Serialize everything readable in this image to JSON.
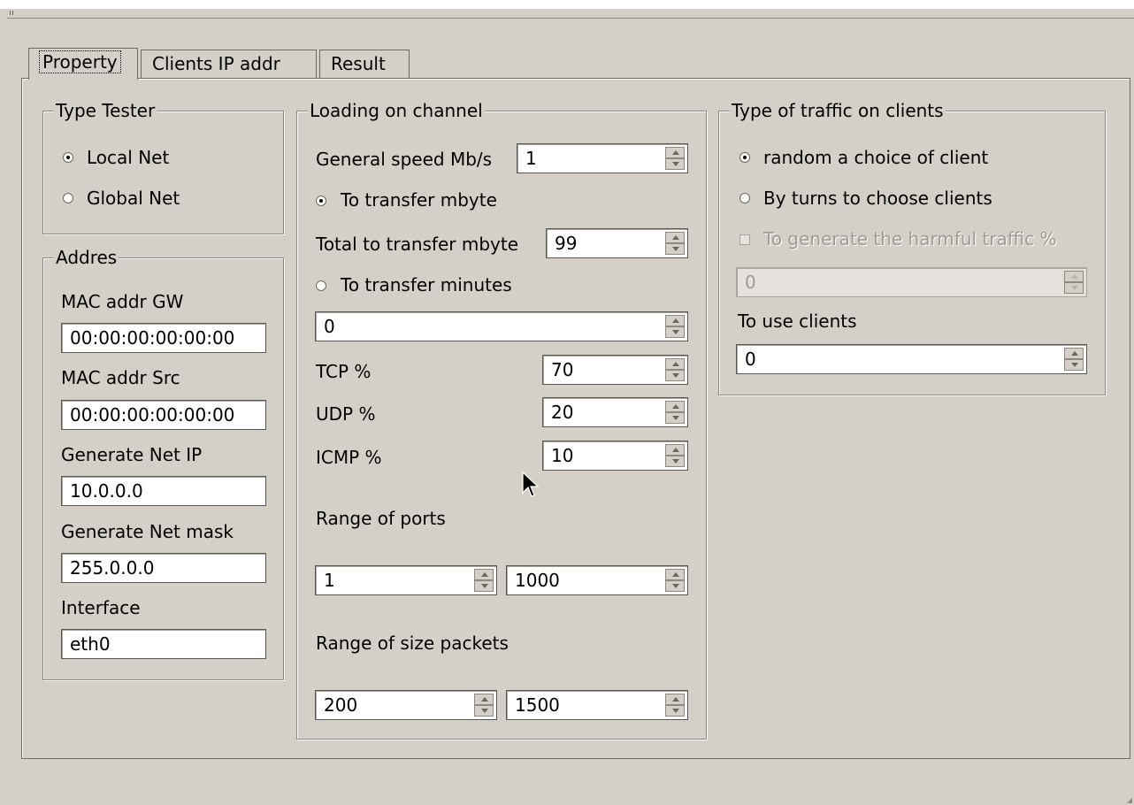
{
  "tabs": [
    {
      "label": "Property",
      "active": true
    },
    {
      "label": "Clients IP addr",
      "active": false
    },
    {
      "label": "Result",
      "active": false
    }
  ],
  "type_tester": {
    "title": "Type Tester",
    "local_net": "Local Net",
    "global_net": "Global Net",
    "selected": "Local Net"
  },
  "addres": {
    "title": "Addres",
    "mac_gw_label": "MAC addr GW",
    "mac_gw_value": "00:00:00:00:00:00",
    "mac_src_label": "MAC addr Src",
    "mac_src_value": "00:00:00:00:00:00",
    "net_ip_label": "Generate Net IP",
    "net_ip_value": "10.0.0.0",
    "net_mask_label": "Generate Net mask",
    "net_mask_value": "255.0.0.0",
    "interface_label": "Interface",
    "interface_value": "eth0"
  },
  "loading": {
    "title": "Loading on channel",
    "general_speed_label": "General speed Mb/s",
    "general_speed_value": "1",
    "transfer_mbyte_label": "To transfer mbyte",
    "total_mbyte_label": "Total to transfer mbyte",
    "total_mbyte_value": "99",
    "transfer_minutes_label": "To transfer minutes",
    "minutes_value": "0",
    "tcp_label": "TCP %",
    "tcp_value": "70",
    "udp_label": "UDP %",
    "udp_value": "20",
    "icmp_label": "ICMP %",
    "icmp_value": "10",
    "range_ports_label": "Range of ports",
    "port_from": "1",
    "port_to": "1000",
    "range_size_label": "Range of size packets",
    "size_from": "200",
    "size_to": "1500",
    "selected": "To transfer mbyte"
  },
  "traffic": {
    "title": "Type of traffic on clients",
    "random_label": "random a choice of client",
    "turns_label": "By turns to choose clients",
    "harmful_label": "To generate the harmful traffic %",
    "harmful_checked": false,
    "harmful_value": "0",
    "use_clients_label": "To use clients",
    "use_clients_value": "0",
    "selected": "random a choice of client"
  }
}
